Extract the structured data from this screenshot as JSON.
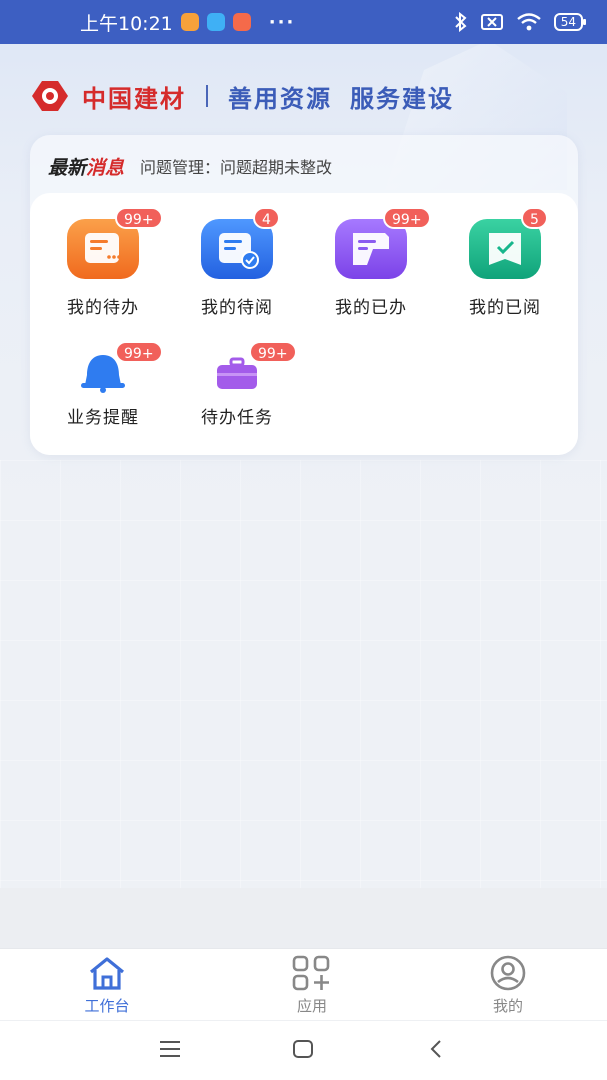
{
  "status_bar": {
    "time": "上午10:21",
    "more": "···",
    "battery": "54"
  },
  "brand": {
    "name": "中国建材",
    "slogan_1": "善用资源",
    "slogan_2": "服务建设"
  },
  "news": {
    "title_part_1": "最新",
    "title_part_2": "消息",
    "text": "问题管理：问题超期未整改"
  },
  "tiles": [
    {
      "label": "我的待办",
      "badge": "99+",
      "icon": "todo-icon",
      "color": "#f57c2c"
    },
    {
      "label": "我的待阅",
      "badge": "4",
      "icon": "to-read-icon",
      "color": "#2f7cf0"
    },
    {
      "label": "我的已办",
      "badge": "99+",
      "icon": "done-icon",
      "color": "#8b5cf0"
    },
    {
      "label": "我的已阅",
      "badge": "5",
      "icon": "read-icon",
      "color": "#18b68c"
    },
    {
      "label": "业务提醒",
      "badge": "99+",
      "icon": "bell-icon",
      "color": "#2f7cf0"
    },
    {
      "label": "待办任务",
      "badge": "99+",
      "icon": "briefcase-icon",
      "color": "#a35bea"
    }
  ],
  "tabbar": {
    "tabs": [
      {
        "label": "工作台",
        "icon": "home-icon",
        "active": true
      },
      {
        "label": "应用",
        "icon": "apps-icon",
        "active": false
      },
      {
        "label": "我的",
        "icon": "profile-icon",
        "active": false
      }
    ],
    "active_color": "#3f6fd8",
    "inactive_color": "#888888"
  },
  "system_nav": {
    "icons": [
      "menu-icon",
      "home-square-icon",
      "back-icon"
    ]
  }
}
